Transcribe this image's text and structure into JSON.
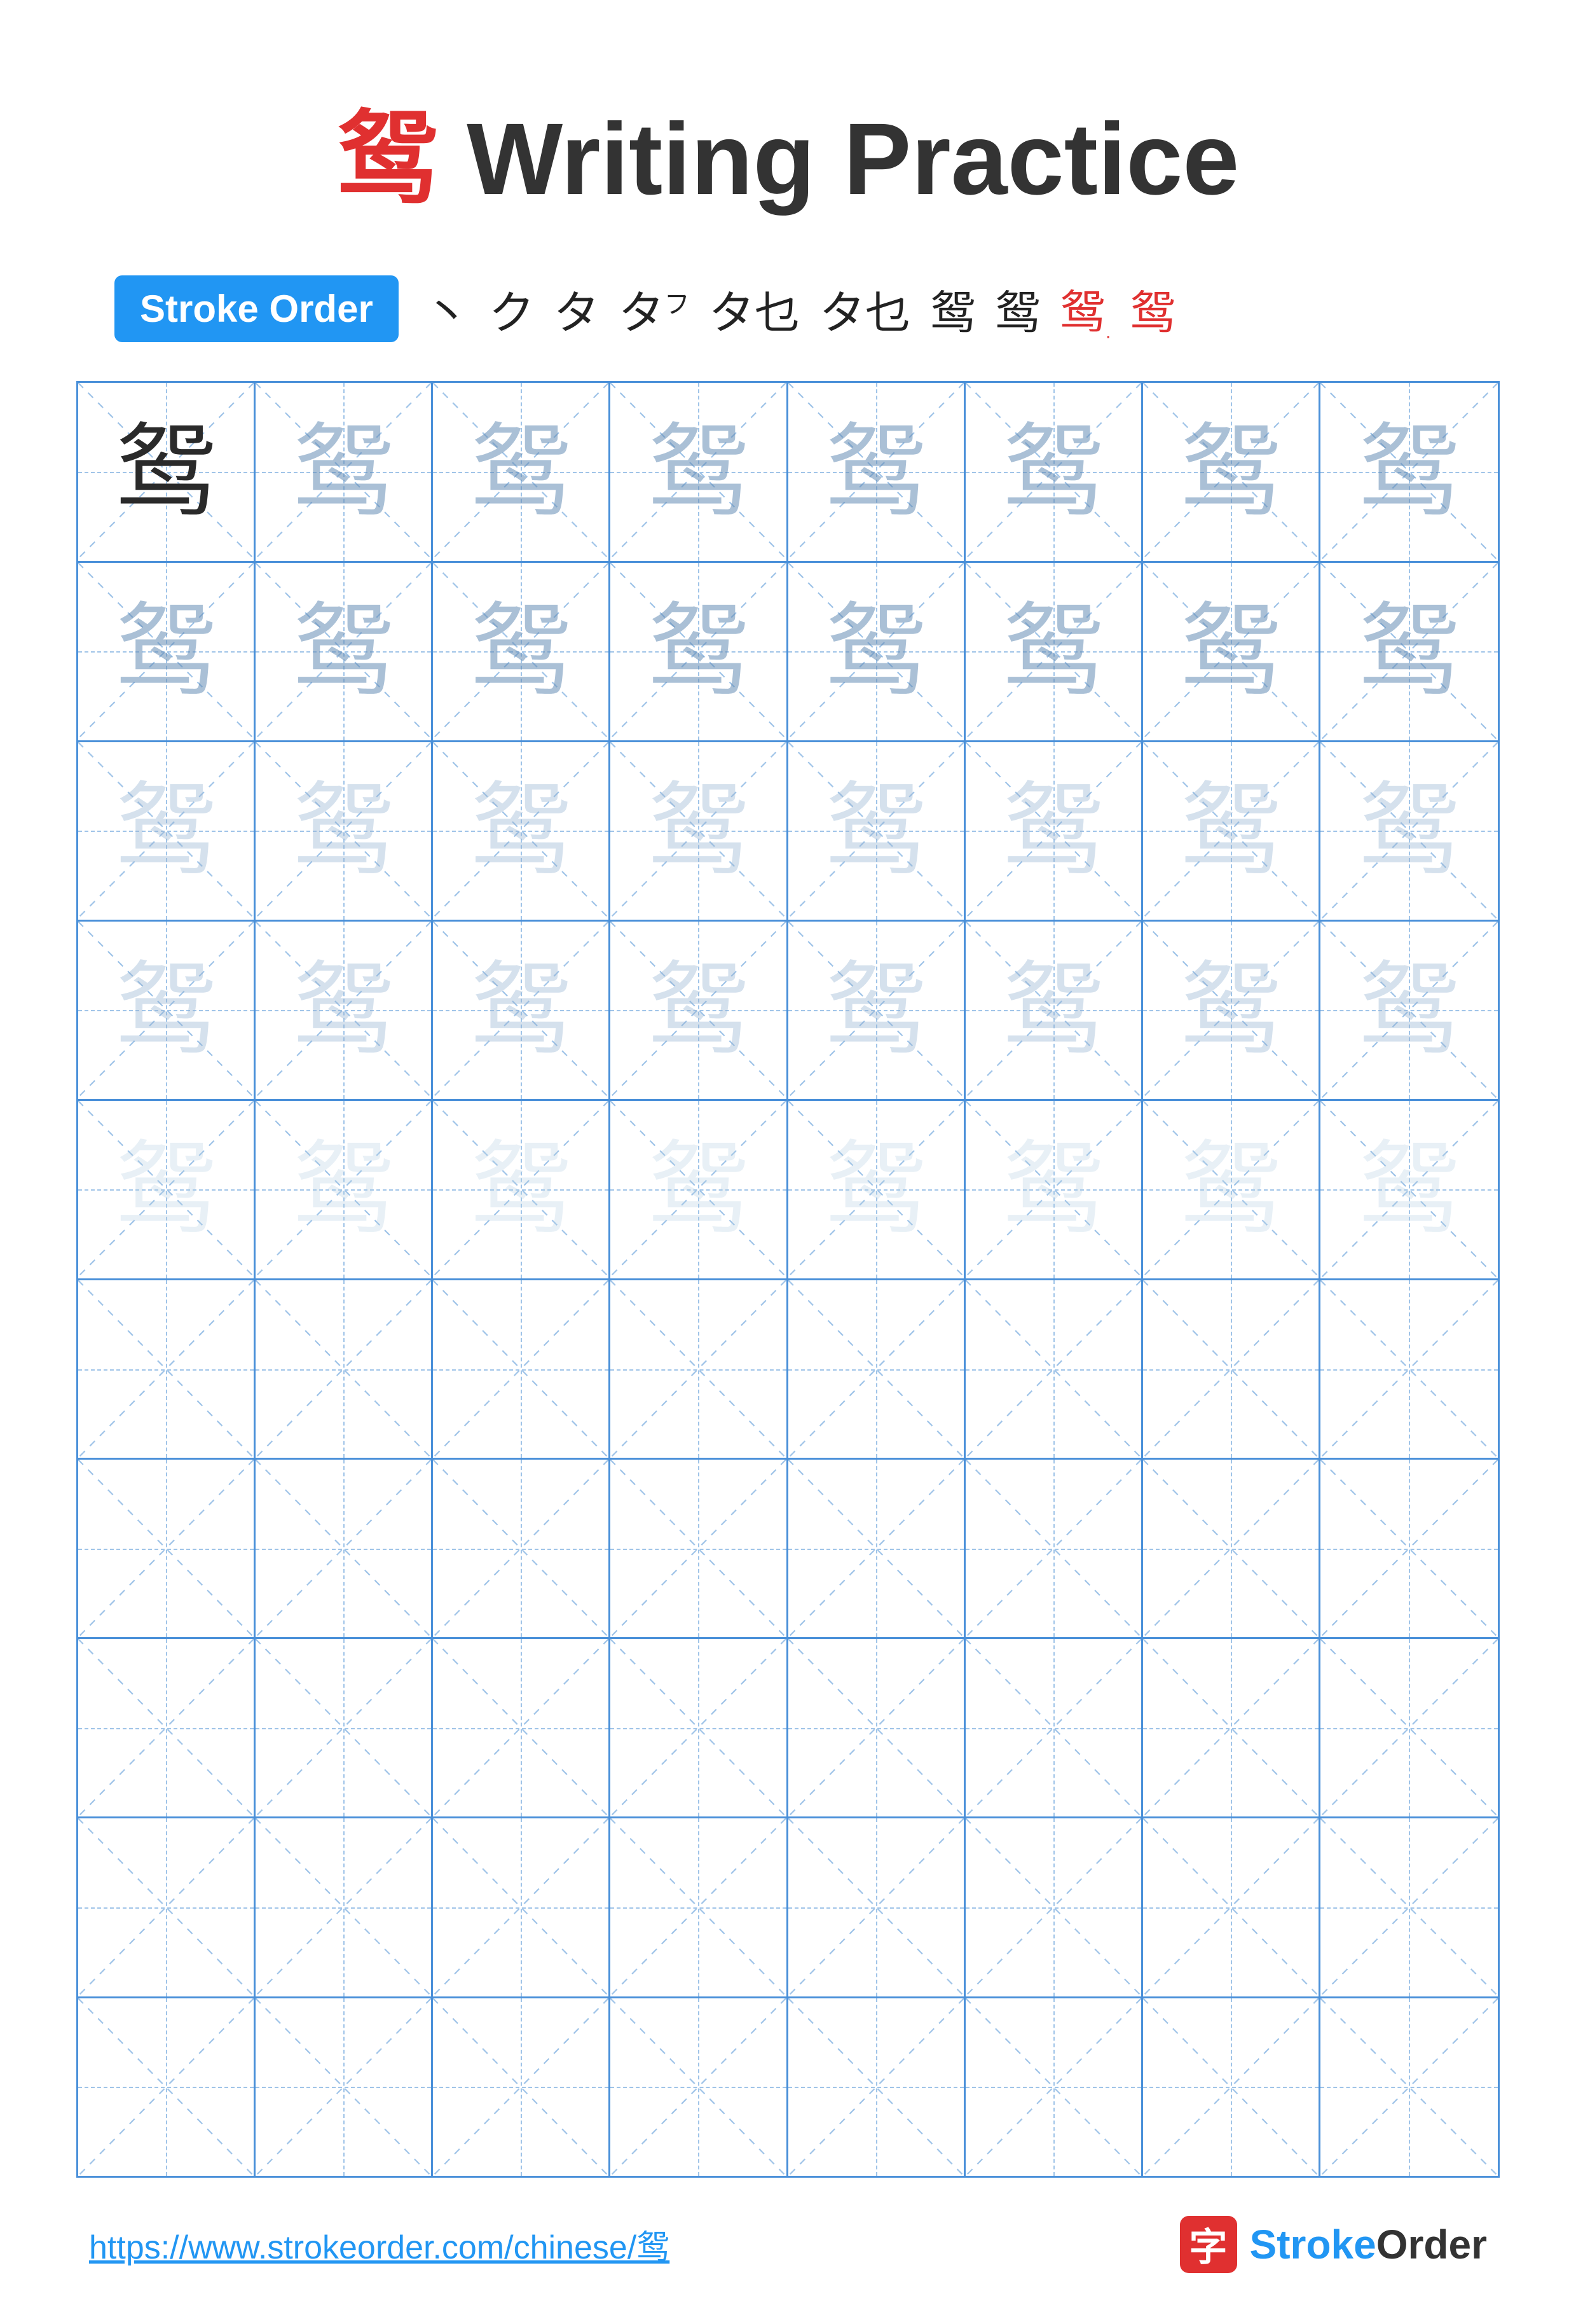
{
  "title": {
    "char": "鸳",
    "suffix": " Writing Practice"
  },
  "stroke_order": {
    "badge_label": "Stroke Order",
    "chars": [
      "丶",
      "ク",
      "タ",
      "タ⁷",
      "タ乜",
      "タ乜",
      "鸳",
      "鸳",
      "鸳",
      "鸳"
    ]
  },
  "grid": {
    "rows": 10,
    "cols": 8,
    "practice_char": "鸳",
    "filled_rows": 5,
    "empty_rows": 5
  },
  "footer": {
    "url": "https://www.strokeorder.com/chinese/鸳",
    "logo_char": "字",
    "logo_name": "StrokeOrder"
  }
}
